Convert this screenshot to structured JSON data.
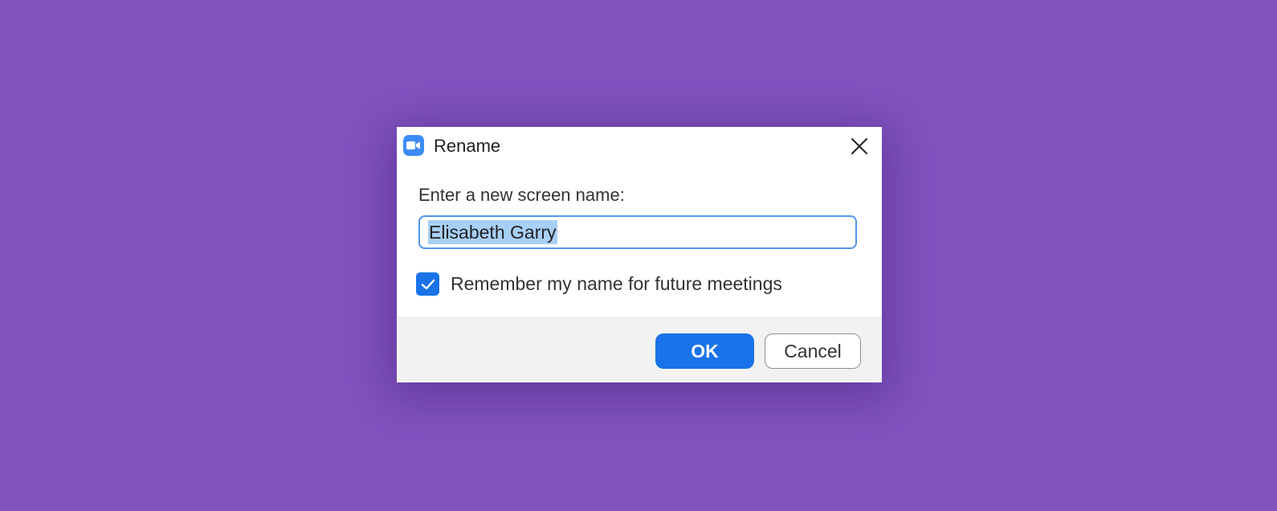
{
  "dialog": {
    "title": "Rename",
    "app_icon": "zoom-video-camera-icon",
    "close_icon": "close-icon",
    "prompt": "Enter a new screen name:",
    "screen_name_value": "Elisabeth Garry",
    "screen_name_selected": true,
    "remember_checked": true,
    "remember_label": "Remember my name for future meetings",
    "ok_label": "OK",
    "cancel_label": "Cancel"
  },
  "colors": {
    "background": "#8153bf",
    "accent": "#1a73e8",
    "app_icon": "#3d8bf7",
    "selection": "#a8cff5",
    "input_focus_border": "#5296ee"
  }
}
